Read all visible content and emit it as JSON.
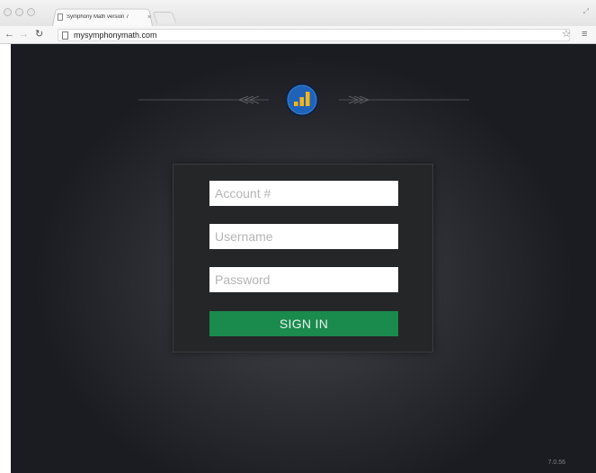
{
  "browser": {
    "tab_title": "Symphony Math version 7",
    "tab_close": "×",
    "url": "mysymphonymath.com"
  },
  "icons": {
    "back": "back-arrow-icon",
    "forward": "forward-arrow-icon",
    "reload": "reload-icon",
    "page": "page-icon",
    "bookmark": "star-icon",
    "menu": "menu-icon",
    "logo": "symphony-math-logo-icon"
  },
  "login": {
    "account_placeholder": "Account #",
    "username_placeholder": "Username",
    "password_placeholder": "Password",
    "sign_in_label": "SIGN IN"
  },
  "footer": {
    "version": "7.0.56"
  },
  "colors": {
    "background": "#2d2e34",
    "panel": "#252628",
    "sign_in": "#1a8a4d",
    "logo_blue": "#1f63b8",
    "logo_yellow": "#f3b51c"
  }
}
